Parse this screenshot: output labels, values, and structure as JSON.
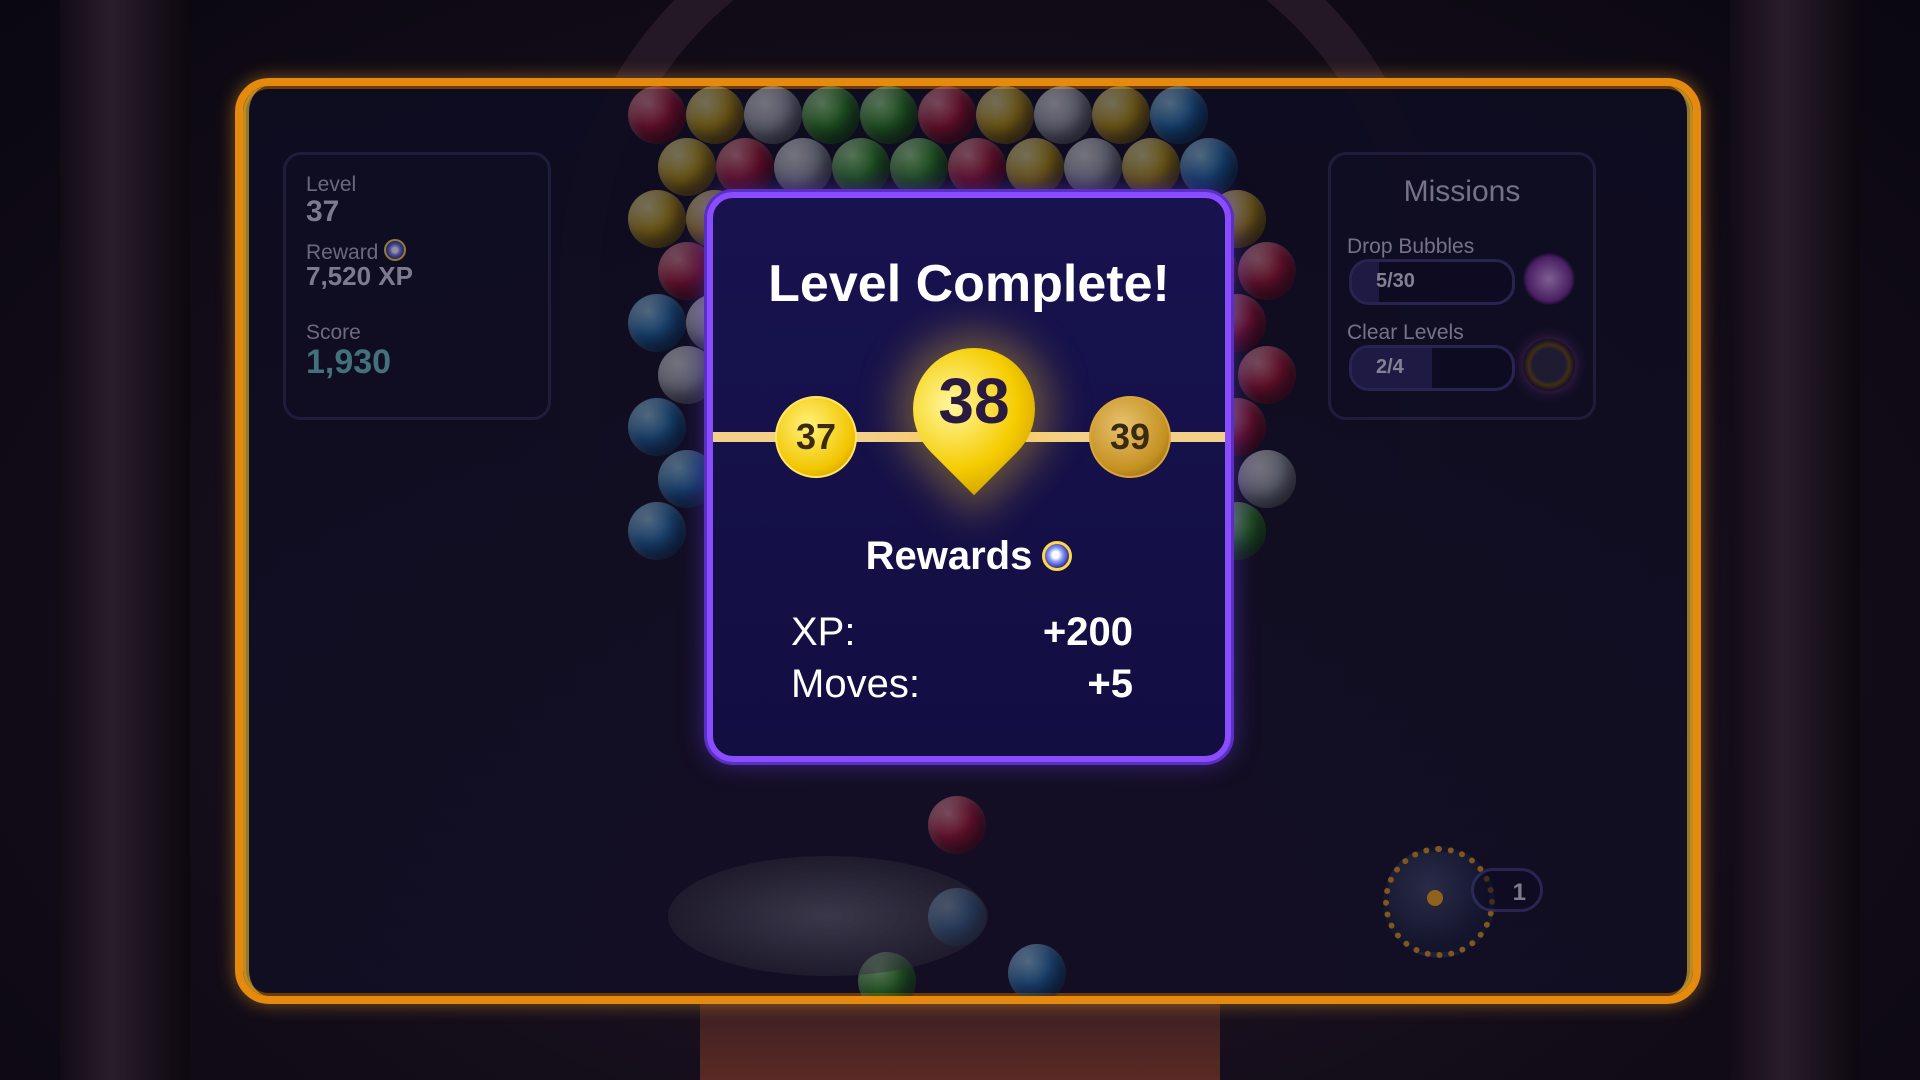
{
  "stats": {
    "level_label": "Level",
    "level_value": "37",
    "reward_label": "Reward",
    "reward_value": "7,520 XP",
    "score_label": "Score",
    "score_value": "1,930"
  },
  "missions": {
    "title": "Missions",
    "items": [
      {
        "label": "Drop Bubbles",
        "progress": "5/30",
        "fraction": 0.17,
        "icon": "swirl-icon"
      },
      {
        "label": "Clear Levels",
        "progress": "2/4",
        "fraction": 0.5,
        "icon": "mine-icon"
      }
    ]
  },
  "booster": {
    "count": "1",
    "icon": "bomb-icon"
  },
  "modal": {
    "title": "Level Complete!",
    "prev_level": "37",
    "current_level": "38",
    "next_level": "39",
    "rewards_heading": "Rewards",
    "rewards": [
      {
        "label": "XP:",
        "value": "+200"
      },
      {
        "label": "Moves:",
        "value": "+5"
      }
    ]
  },
  "colors": {
    "frame": "#e5890f",
    "modal_border": "#8a4cff",
    "modal_bg": "#18134f",
    "gold": "#f5cc00"
  }
}
